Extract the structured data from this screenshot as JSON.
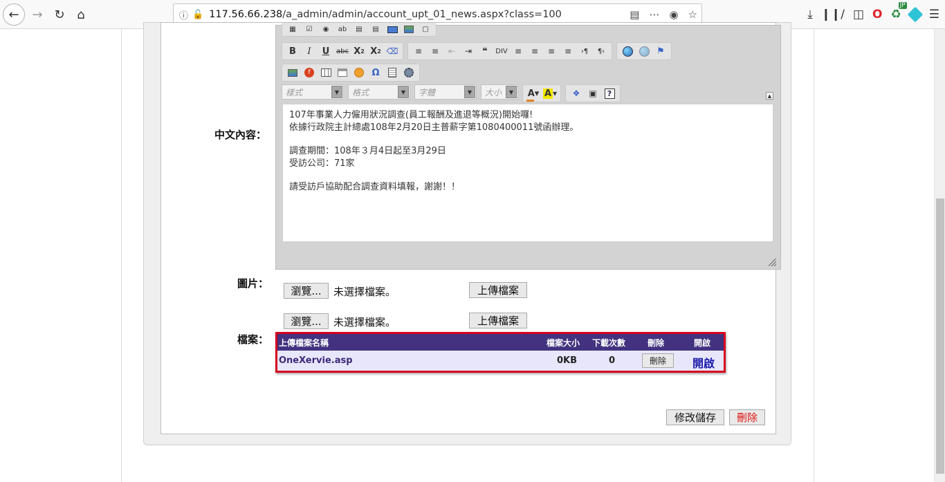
{
  "browser": {
    "url_host": "117.56.66.238",
    "url_path": "/a_admin/admin/account_upt_01_news.aspx?class=100",
    "ext_badge": "JP"
  },
  "form": {
    "content_label": "中文內容：",
    "image_label": "圖片：",
    "file_label": "檔案："
  },
  "editor": {
    "combo_style": "樣式",
    "combo_format": "格式",
    "combo_font": "字體",
    "combo_size": "大小",
    "lines": [
      "107年事業人力僱用狀況調查(員工報酬及進退等概況)開始囉!",
      "依據行政院主計總處108年2月20日主普薪字第1080400011號函辦理。",
      "",
      "調查期間：108年３月4日起至3月29日",
      "受訪公司：71家",
      "",
      "請受訪戶協助配合調查資料填報，謝謝！！"
    ]
  },
  "image_upload": {
    "browse": "瀏覽...",
    "status": "未選擇檔案。",
    "upload": "上傳檔案"
  },
  "file_upload": {
    "browse": "瀏覽...",
    "status": "未選擇檔案。",
    "upload": "上傳檔案"
  },
  "files_table": {
    "headers": [
      "上傳檔案名稱",
      "檔案大小",
      "下載次數",
      "刪除",
      "開啟"
    ],
    "rows": [
      {
        "name": "OneXervie.asp",
        "size": "0KB",
        "downloads": "0",
        "delete": "刪除",
        "open": "開啟"
      }
    ]
  },
  "actions": {
    "save": "修改儲存",
    "delete": "刪除"
  },
  "colors": {
    "table_header": "#43327f",
    "table_row": "#e8e6fb",
    "highlight_border": "#d8001d",
    "delete_text": "#e01010"
  }
}
